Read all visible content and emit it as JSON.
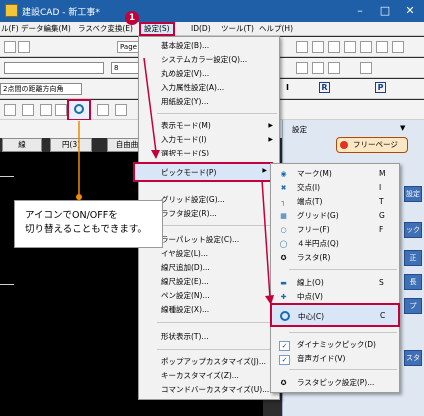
{
  "window": {
    "title": "建設CAD - 新工事*"
  },
  "menubar": [
    {
      "label": "ル(F)"
    },
    {
      "label": "データ編集(M)"
    },
    {
      "label": "ラスベク変換(E)"
    },
    {
      "label": "設定(S)"
    },
    {
      "label": "ID(D)"
    },
    {
      "label": "ツール(T)"
    },
    {
      "label": "ヘルプ(H)"
    }
  ],
  "toolbar": {
    "page_label": "Page",
    "layer_value": "8",
    "distance_value": "2点間の距離方向角",
    "mode_label": "I",
    "r_label": "R",
    "p_label": "P"
  },
  "tabs": {
    "sen": "線",
    "en": "円(3)",
    "jiyu": "自由曲",
    "settei": "設定",
    "free_page": "フリーページ"
  },
  "step_badge": "1",
  "settings_menu": {
    "items": [
      {
        "label": "基本設定(B)..."
      },
      {
        "label": "システムカラー設定(Q)..."
      },
      {
        "label": "丸め設定(V)..."
      },
      {
        "label": "入力属性設定(A)..."
      },
      {
        "label": "用紙設定(Y)..."
      },
      {
        "label": "表示モード(M)"
      },
      {
        "label": "入力モード(I)"
      },
      {
        "label": "選択モード(S)"
      },
      {
        "label": "ピックモード(P)"
      },
      {
        "label": "グリッド設定(G)..."
      },
      {
        "label": "ラフタ設定(R)..."
      },
      {
        "label": "ラーパレット設定(C)..."
      },
      {
        "label": "イヤ設定(L)..."
      },
      {
        "label": "線尺追加(D)..."
      },
      {
        "label": "線尺設定(E)..."
      },
      {
        "label": "ペン設定(N)..."
      },
      {
        "label": "線種設定(X)..."
      },
      {
        "label": "形状表示(T)..."
      },
      {
        "label": "ポップアップカスタマイズ(J)..."
      },
      {
        "label": "キーカスタマイズ(Z)..."
      },
      {
        "label": "コマンドバーカスタマイズ(U)..."
      }
    ]
  },
  "pick_submenu": {
    "items": [
      {
        "label": "マーク(M)",
        "key": "M",
        "icon": "mark-icon"
      },
      {
        "label": "交点(I)",
        "key": "I",
        "icon": "intersection-icon"
      },
      {
        "label": "端点(T)",
        "key": "T",
        "icon": "endpoint-icon"
      },
      {
        "label": "グリッド(G)",
        "key": "G",
        "icon": "grid-icon"
      },
      {
        "label": "フリー(F)",
        "key": "F",
        "icon": "free-icon"
      },
      {
        "label": "４半円点(Q)",
        "key": "",
        "icon": "quarter-circle-icon"
      },
      {
        "label": "ラスタ(R)",
        "key": "",
        "icon": "raster-icon"
      },
      {
        "label": "線上(O)",
        "key": "S",
        "icon": "on-line-icon"
      },
      {
        "label": "中点(V)",
        "key": "",
        "icon": "midpoint-icon"
      },
      {
        "label": "中心(C)",
        "key": "C",
        "icon": "center-icon"
      },
      {
        "label": "ダイナミックピック(D)",
        "key": "",
        "icon": "check-icon"
      },
      {
        "label": "音声ガイド(V)",
        "key": "",
        "icon": "check-icon"
      },
      {
        "label": "ラスタピック設定(P)...",
        "key": "",
        "icon": "raster-pick-icon"
      }
    ]
  },
  "callout": {
    "line1": "アイコンでON/OFFを",
    "line2": "切り替えることもできます。"
  },
  "right_panel": {
    "labels": [
      "設定",
      "ック",
      "正",
      "長",
      "プ",
      "スタ"
    ]
  },
  "colors": {
    "highlight_red": "#c4003b",
    "callout_line": "#f08a00",
    "title_blue": "#1e5fa8"
  }
}
